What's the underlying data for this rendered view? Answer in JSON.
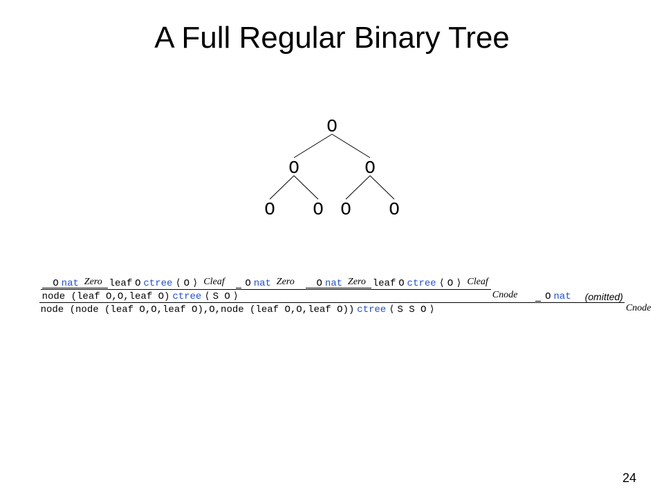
{
  "title": "A Full Regular Binary Tree",
  "tree": {
    "nodes": [
      "O",
      "O",
      "O",
      "O",
      "O",
      "O",
      "O"
    ]
  },
  "terms": {
    "O": "O",
    "nat": "nat",
    "leaf": "leaf",
    "node": "node",
    "ctree": "ctree",
    "SO": "S O",
    "SSO": "S S O",
    "lb": "⟨",
    "rb": "⟩",
    "lp": "(",
    "rp": ")",
    "c": ",",
    "sp": " ",
    "leaf_OO_leaf_O": "(leaf O,O,leaf O)",
    "leaf_O_ctree_O_open": "leaf O ",
    "node_open": "node ",
    "big_inner": "(node (leaf O,O,leaf O),O,node (leaf O,O,leaf O))"
  },
  "rules": {
    "Zero": "Zero",
    "Cleaf": "Cleaf",
    "Cnode": "Cnode",
    "omitted": "(omitted)"
  },
  "pagenum": "24"
}
